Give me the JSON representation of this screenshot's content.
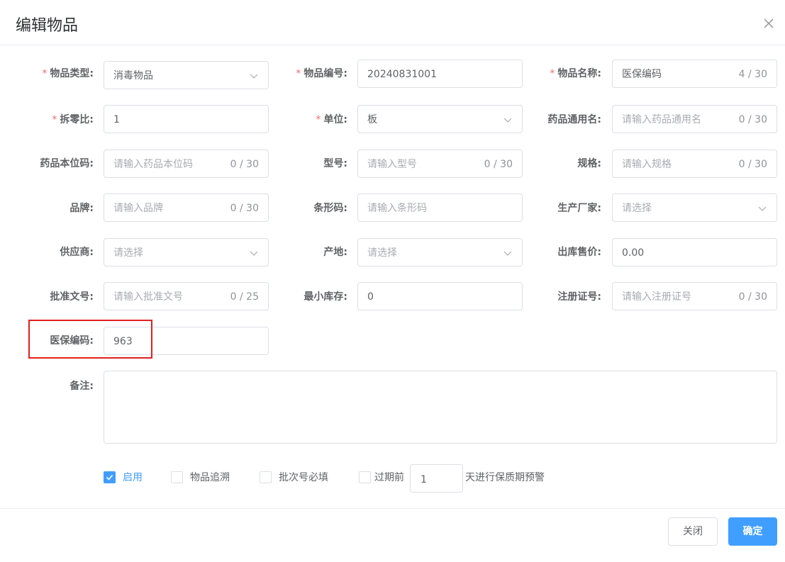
{
  "dialog": {
    "title": "编辑物品"
  },
  "required_mark": "*",
  "fields": {
    "item_type": {
      "label": "物品类型:",
      "value": "消毒物品"
    },
    "item_code": {
      "label": "物品编号:",
      "value": "20240831001"
    },
    "item_name": {
      "label": "物品名称:",
      "value": "医保编码",
      "count": "4 / 30"
    },
    "split_ratio": {
      "label": "拆零比:",
      "value": "1"
    },
    "unit": {
      "label": "单位:",
      "value": "板"
    },
    "generic_name": {
      "label": "药品通用名:",
      "placeholder": "请输入药品通用名",
      "count": "0 / 30"
    },
    "local_code": {
      "label": "药品本位码:",
      "placeholder": "请输入药品本位码",
      "count": "0 / 30"
    },
    "model": {
      "label": "型号:",
      "placeholder": "请输入型号",
      "count": "0 / 30"
    },
    "spec": {
      "label": "规格:",
      "placeholder": "请输入规格",
      "count": "0 / 30"
    },
    "brand": {
      "label": "品牌:",
      "placeholder": "请输入品牌",
      "count": "0 / 30"
    },
    "barcode": {
      "label": "条形码:",
      "placeholder": "请输入条形码"
    },
    "manufacturer": {
      "label": "生产厂家:",
      "placeholder": "请选择"
    },
    "supplier": {
      "label": "供应商:",
      "placeholder": "请选择"
    },
    "origin": {
      "label": "产地:",
      "placeholder": "请选择"
    },
    "sale_price": {
      "label": "出库售价:",
      "value": "0.00"
    },
    "approval_no": {
      "label": "批准文号:",
      "placeholder": "请输入批准文号",
      "count": "0 / 25"
    },
    "min_stock": {
      "label": "最小库存:",
      "value": "0"
    },
    "reg_no": {
      "label": "注册证号:",
      "placeholder": "请输入注册证号",
      "count": "0 / 30"
    },
    "insurance_code": {
      "label": "医保编码:",
      "value": "963"
    },
    "remark": {
      "label": "备注:"
    }
  },
  "options": {
    "enabled": {
      "label": "启用",
      "checked": true
    },
    "trace": {
      "label": "物品追溯",
      "checked": false
    },
    "batch_required": {
      "label": "批次号必填",
      "checked": false
    },
    "expiry_prefix": {
      "label": "过期前",
      "checked": false
    },
    "expiry_days": "1",
    "expiry_suffix": "天进行保质期预警"
  },
  "footer": {
    "cancel_label": "关闭",
    "ok_label": "确定"
  },
  "colors": {
    "primary": "#409eff",
    "required": "#f56c6c",
    "highlight": "#e02020"
  },
  "icons": {
    "close": "close-icon",
    "dropdown": "chevron-down-icon",
    "check": "check-icon"
  }
}
